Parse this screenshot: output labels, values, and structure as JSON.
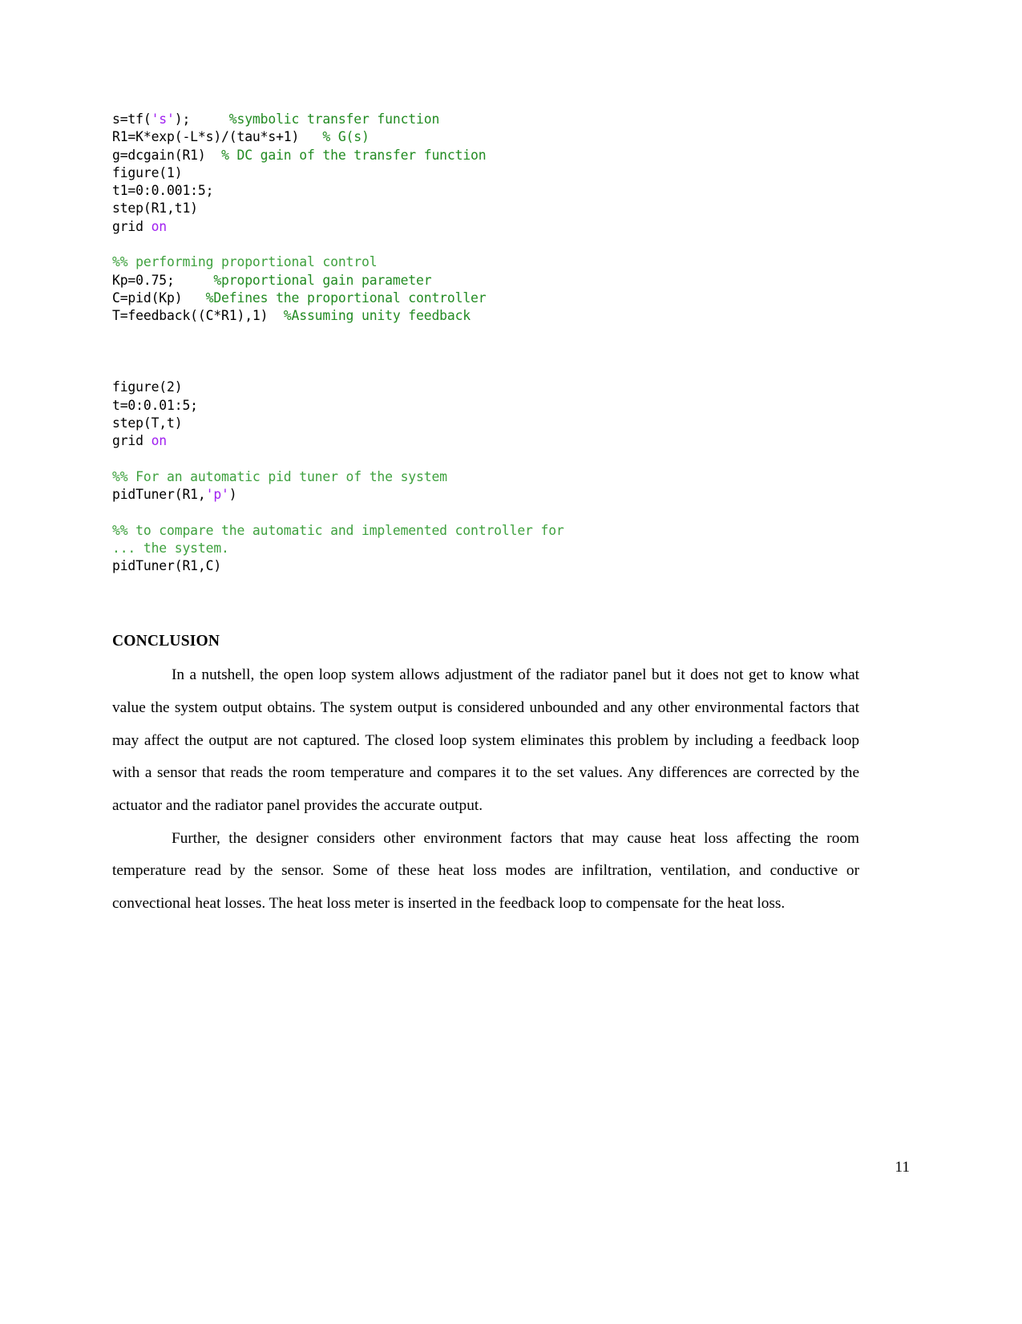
{
  "document": {
    "page_number": "11"
  },
  "code_block": {
    "language": "matlab",
    "colors": {
      "code": "#000000",
      "string": "#a020f0",
      "keyword": "#a020f0",
      "comment": "#228B22",
      "section_comment": "#3fa13f"
    },
    "lines": [
      {
        "type": "code",
        "spans": [
          {
            "t": "code",
            "v": "s=tf("
          },
          {
            "t": "string",
            "v": "'s'"
          },
          {
            "t": "code",
            "v": ");     "
          },
          {
            "t": "comment",
            "v": "%symbolic transfer function"
          }
        ]
      },
      {
        "type": "code",
        "spans": [
          {
            "t": "code",
            "v": "R1=K*exp(-L*s)/(tau*s+1)   "
          },
          {
            "t": "comment",
            "v": "% G(s)"
          }
        ]
      },
      {
        "type": "code",
        "spans": [
          {
            "t": "code",
            "v": "g=dcgain(R1)  "
          },
          {
            "t": "comment",
            "v": "% DC gain of the transfer function"
          }
        ]
      },
      {
        "type": "code",
        "spans": [
          {
            "t": "code",
            "v": "figure(1)"
          }
        ]
      },
      {
        "type": "code",
        "spans": [
          {
            "t": "code",
            "v": "t1=0:0.001:5;"
          }
        ]
      },
      {
        "type": "code",
        "spans": [
          {
            "t": "code",
            "v": "step(R1,t1)"
          }
        ]
      },
      {
        "type": "code",
        "spans": [
          {
            "t": "code",
            "v": "grid "
          },
          {
            "t": "keyword",
            "v": "on"
          }
        ]
      },
      {
        "type": "blank",
        "spans": []
      },
      {
        "type": "code",
        "spans": [
          {
            "t": "section",
            "v": "%% performing proportional control"
          }
        ]
      },
      {
        "type": "code",
        "spans": [
          {
            "t": "code",
            "v": "Kp=0.75;     "
          },
          {
            "t": "comment",
            "v": "%proportional gain parameter"
          }
        ]
      },
      {
        "type": "code",
        "spans": [
          {
            "t": "code",
            "v": "C=pid(Kp)   "
          },
          {
            "t": "comment",
            "v": "%Defines the proportional controller"
          }
        ]
      },
      {
        "type": "code",
        "spans": [
          {
            "t": "code",
            "v": "T=feedback((C*R1),1)  "
          },
          {
            "t": "comment",
            "v": "%Assuming unity feedback"
          }
        ]
      },
      {
        "type": "blank",
        "spans": []
      },
      {
        "type": "blank",
        "spans": []
      },
      {
        "type": "blank",
        "spans": []
      },
      {
        "type": "code",
        "spans": [
          {
            "t": "code",
            "v": "figure(2)"
          }
        ]
      },
      {
        "type": "code",
        "spans": [
          {
            "t": "code",
            "v": "t=0:0.01:5;"
          }
        ]
      },
      {
        "type": "code",
        "spans": [
          {
            "t": "code",
            "v": "step(T,t)"
          }
        ]
      },
      {
        "type": "code",
        "spans": [
          {
            "t": "code",
            "v": "grid "
          },
          {
            "t": "keyword",
            "v": "on"
          }
        ]
      },
      {
        "type": "blank",
        "spans": []
      },
      {
        "type": "code",
        "spans": [
          {
            "t": "section",
            "v": "%% For an automatic pid tuner of the system"
          }
        ]
      },
      {
        "type": "code",
        "spans": [
          {
            "t": "code",
            "v": "pidTuner(R1,"
          },
          {
            "t": "string",
            "v": "'p'"
          },
          {
            "t": "code",
            "v": ")"
          }
        ]
      },
      {
        "type": "blank",
        "spans": []
      },
      {
        "type": "code",
        "spans": [
          {
            "t": "section",
            "v": "%% to compare the automatic and implemented controller for"
          }
        ]
      },
      {
        "type": "code",
        "spans": [
          {
            "t": "section",
            "v": "... the system."
          }
        ]
      },
      {
        "type": "code",
        "spans": [
          {
            "t": "code",
            "v": "pidTuner(R1,C)"
          }
        ]
      }
    ]
  },
  "conclusion": {
    "heading": "CONCLUSION",
    "paragraphs": [
      "In a nutshell, the open loop system allows adjustment of the radiator panel but it does not get to know what value the system output obtains. The system output is considered unbounded and any other environmental factors that may affect the output are not captured. The closed loop system eliminates this problem by including a feedback loop with a sensor that reads the room temperature and compares it to the set values. Any differences are corrected by the actuator and the radiator panel provides the accurate output.",
      "Further, the designer considers other environment factors that may cause heat loss affecting the room temperature read by the sensor. Some of these heat loss modes are infiltration, ventilation, and conductive or convectional heat losses. The heat loss meter is inserted in the feedback loop to compensate for the heat loss."
    ]
  }
}
